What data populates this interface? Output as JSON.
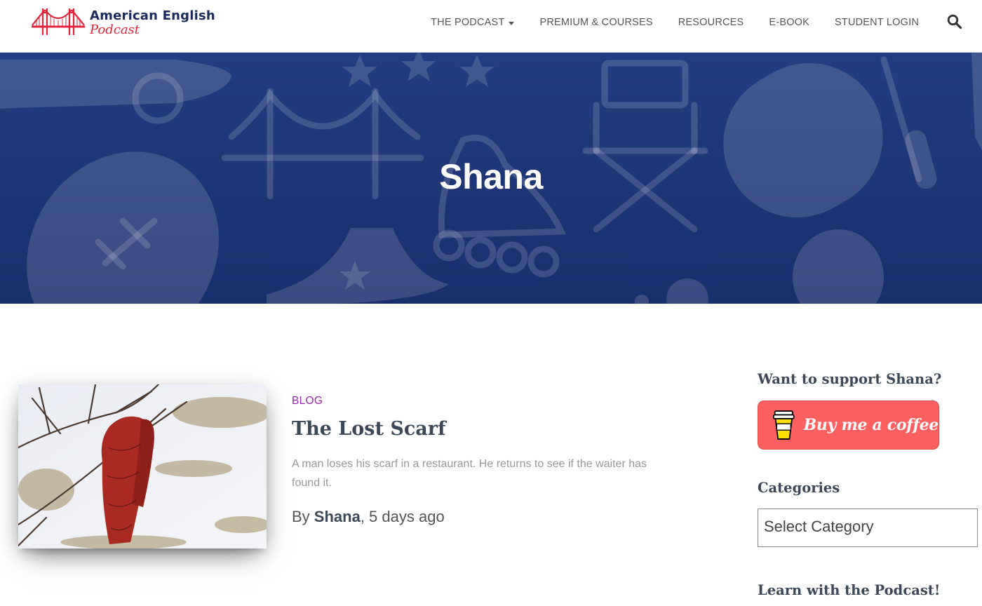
{
  "site": {
    "logo_title": "American English",
    "logo_subtitle": "Podcast",
    "brand_red": "#e5233b",
    "brand_navy": "#1b2a5c"
  },
  "nav": {
    "items": [
      {
        "label": "THE PODCAST",
        "icon": "caret-down-icon"
      },
      {
        "label": "PREMIUM & COURSES"
      },
      {
        "label": "RESOURCES"
      },
      {
        "label": "E-BOOK"
      },
      {
        "label": "STUDENT LOGIN"
      }
    ],
    "search_icon": "search-icon"
  },
  "hero": {
    "title": "Shana",
    "background": "#1e3576"
  },
  "post": {
    "category": "BLOG",
    "title": "The Lost Scarf",
    "excerpt": "A man loses his scarf in a restaurant. He returns to see if the waiter has found it.",
    "by": "By ",
    "author": "Shana",
    "time": ", 5 days ago",
    "category_color": "#9c27b0"
  },
  "sidebar": {
    "support_heading": "Want to support Shana?",
    "coffee_button": "Buy me a coffee",
    "coffee_color": "#ff5f5f",
    "categories_heading": "Categories",
    "category_select": "Select Category",
    "podcast_heading": "Learn with the Podcast!"
  }
}
